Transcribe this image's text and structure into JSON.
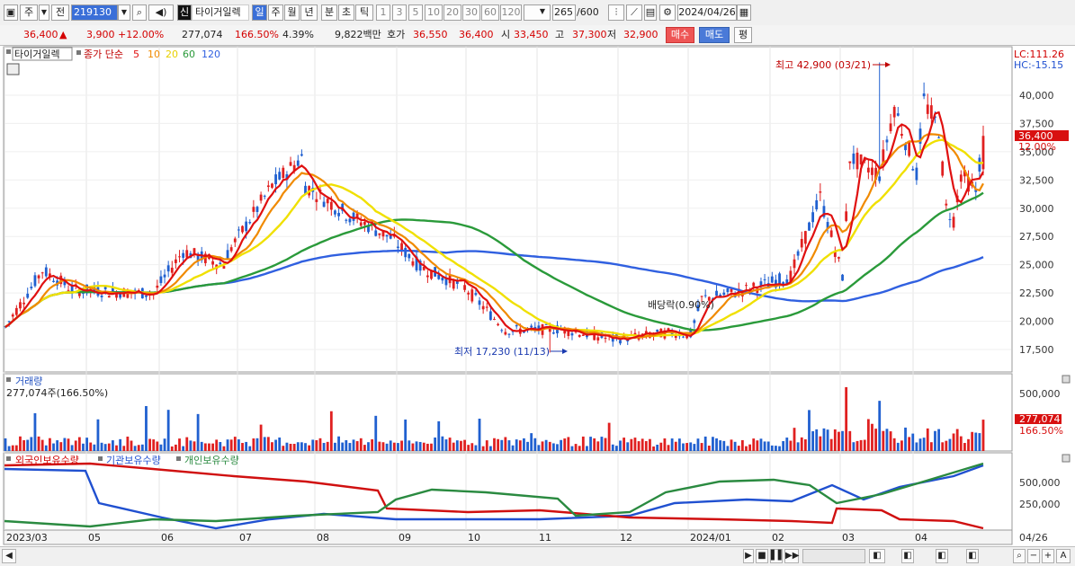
{
  "toolbar": {
    "market_label": "주",
    "prev_label": "전",
    "stock_code": "219130",
    "new_badge": "신",
    "stock_name": "타이거일렉",
    "periods": [
      "일",
      "주",
      "월",
      "년",
      "분",
      "초",
      "틱"
    ],
    "intervals": [
      "1",
      "3",
      "5",
      "10",
      "20",
      "30",
      "60",
      "120"
    ],
    "count": "265",
    "count_total": "/600",
    "date": "2024/04/26"
  },
  "quote": {
    "price": "36,400",
    "change": "3,900",
    "change_pct": "+12.00%",
    "volume": "277,074",
    "volume_ratio": "166.50%",
    "turnover": "4.39%",
    "amount": "9,822백만",
    "ask_label": "호가",
    "ask": "36,550",
    "bid": "36,400",
    "open_label": "시",
    "open": "33,450",
    "high_label": "고",
    "high": "37,300",
    "low_label": "저",
    "low": "32,900",
    "buy_btn": "매수",
    "sell_btn": "매도",
    "eval_btn": "평"
  },
  "price_panel": {
    "stock_label": "타이거일렉",
    "ma_label": "종가 단순",
    "ma_periods": [
      "5",
      "10",
      "20",
      "60",
      "120"
    ],
    "lc": "LC:111.26",
    "hc": "HC:-15.15",
    "current_price": "36,400",
    "current_pct": "12.00%",
    "max_annotation": "최고 42,900 (03/21)",
    "min_annotation": "최저 17,230 (11/13)",
    "dividend_annotation": "배당락(0.90%)",
    "y_ticks": [
      "40,000",
      "37,500",
      "35,000",
      "32,500",
      "30,000",
      "27,500",
      "25,000",
      "22,500",
      "20,000",
      "17,500"
    ]
  },
  "volume_panel": {
    "title": "거래량",
    "value": "277,074주(166.50%)",
    "y_ticks": [
      "500,000"
    ],
    "current": "277,074",
    "current_pct": "166.50%"
  },
  "holdings_panel": {
    "series_labels": [
      "외국인보유수량",
      "기관보유수량",
      "개인보유수량"
    ],
    "y_ticks": [
      "500,000",
      "250,000"
    ]
  },
  "x_axis": {
    "labels": [
      "2023/03",
      "05",
      "06",
      "07",
      "08",
      "09",
      "10",
      "11",
      "12",
      "2024/01",
      "02",
      "03",
      "04"
    ],
    "last_date": "04/26"
  },
  "colors": {
    "ma5": "#e01010",
    "ma10": "#f08a00",
    "ma20": "#f0e000",
    "ma60": "#2a9a3a",
    "ma120": "#3060e0",
    "up": "#e02020",
    "down": "#2060d0"
  },
  "chart_data": {
    "type": "candlestick",
    "title": "타이거일렉 (219130) 일봉",
    "x_range": [
      "2023/03",
      "2024/04/26"
    ],
    "price_range": [
      16000,
      42900
    ],
    "ma_close_approx": [
      {
        "date": "2023/03",
        "value": 19500
      },
      {
        "date": "2023/04",
        "value": 23500
      },
      {
        "date": "2023/05",
        "value": 22500
      },
      {
        "date": "2023/06",
        "value": 25000
      },
      {
        "date": "2023/07",
        "value": 32000
      },
      {
        "date": "2023/08",
        "value": 29000
      },
      {
        "date": "2023/09",
        "value": 25500
      },
      {
        "date": "2023/10",
        "value": 20500
      },
      {
        "date": "2023/11",
        "value": 18000
      },
      {
        "date": "2023/12",
        "value": 18800
      },
      {
        "date": "2024/01",
        "value": 22000
      },
      {
        "date": "2024/02",
        "value": 24000
      },
      {
        "date": "2024/03",
        "value": 33000
      },
      {
        "date": "2024/04",
        "value": 38000
      },
      {
        "date": "2024/04/26",
        "value": 36400
      }
    ],
    "max": {
      "date": "03/21",
      "value": 42900
    },
    "min": {
      "date": "11/13",
      "value": 17230
    },
    "last": {
      "close": 36400,
      "open": 33450,
      "high": 37300,
      "low": 32900,
      "volume": 277074
    }
  }
}
